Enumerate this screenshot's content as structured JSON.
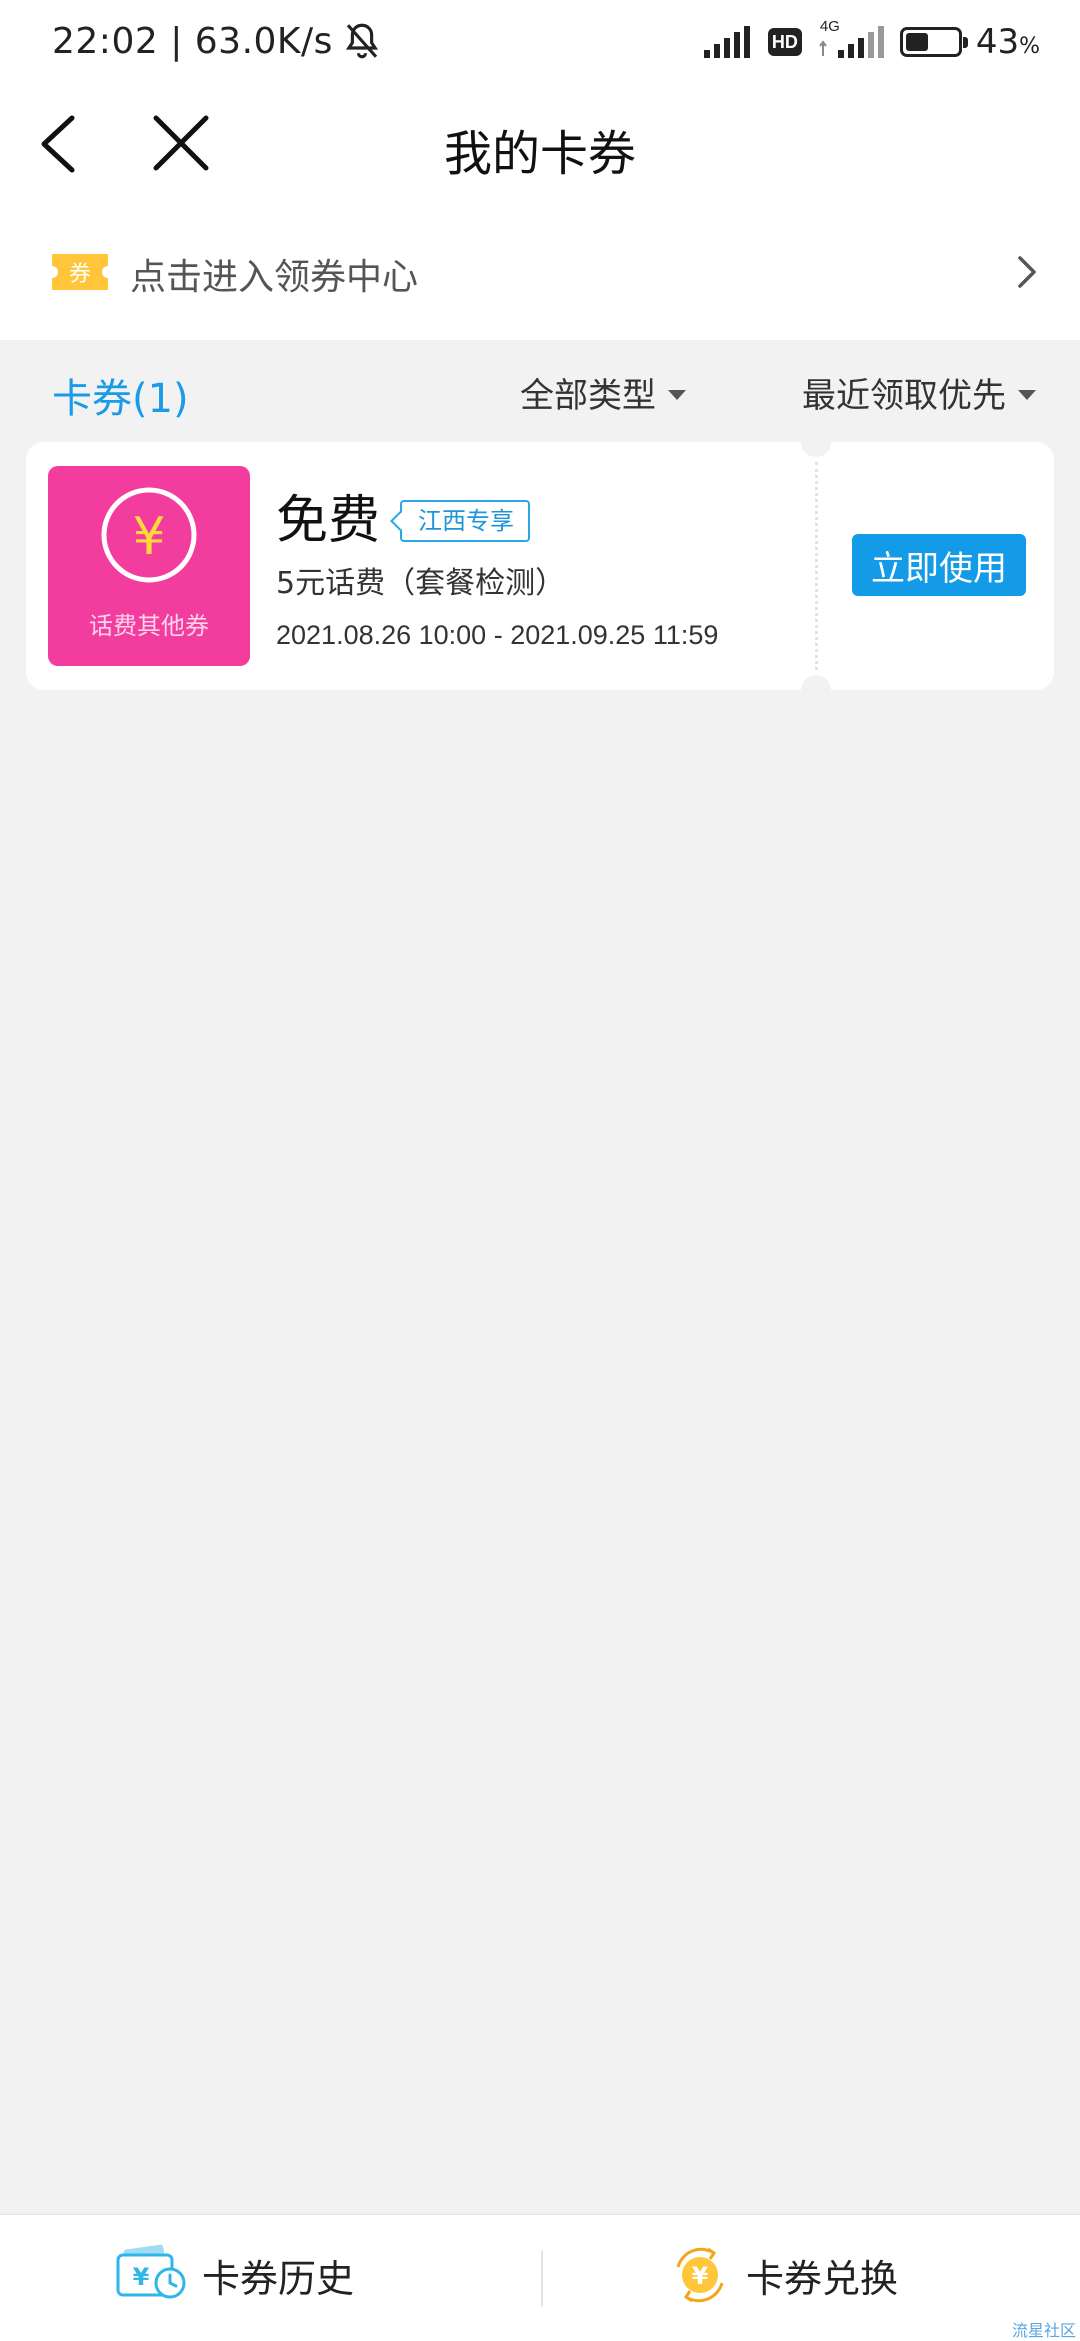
{
  "status_bar": {
    "time_speed": "22:02 | 63.0K/s",
    "hd": "HD",
    "network": "4G",
    "battery_level": 0.43,
    "battery_percent": "43",
    "battery_unit": "%"
  },
  "nav": {
    "title": "我的卡券"
  },
  "coupon_center": {
    "ticket_icon_text": "券",
    "label": "点击进入领券中心"
  },
  "filters": {
    "count_tab": "卡券(1)",
    "type_label": "全部类型",
    "sort_label": "最近领取优先"
  },
  "coupons": [
    {
      "badge_symbol": "¥",
      "badge_label": "话费其他券",
      "title": "免费",
      "region_tag": "江西专享",
      "description": "5元话费（套餐检测）",
      "validity": "2021.08.26 10:00 - 2021.09.25 11:59",
      "action_label": "立即使用"
    }
  ],
  "bottom_bar": {
    "history_label": "卡券历史",
    "exchange_label": "卡券兑换"
  },
  "watermark": "流星社区",
  "colors": {
    "accent_blue": "#149be8",
    "badge_pink": "#f23d9e",
    "ticket_yellow": "#ffc63a",
    "background": "#f2f2f2"
  }
}
